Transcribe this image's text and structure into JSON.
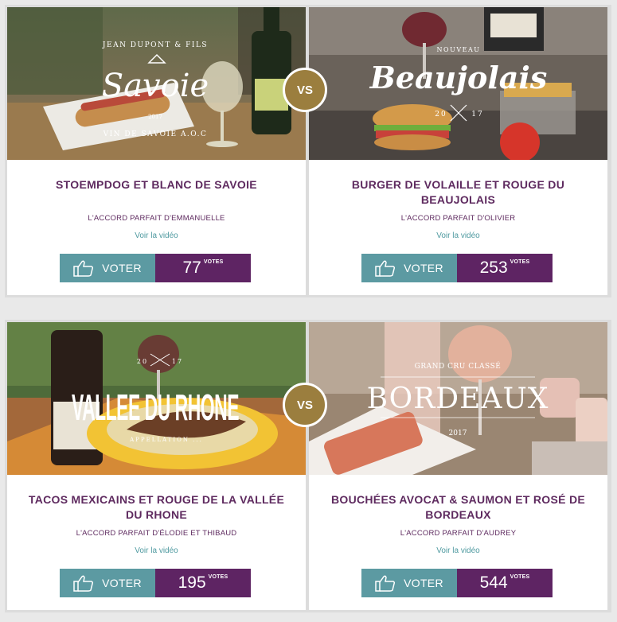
{
  "matchups": [
    {
      "vs": "VS",
      "left": {
        "badge_top": "JEAN DUPONT & FILS",
        "badge_main": "Savoie",
        "badge_year": "2017",
        "badge_bottom": "VIN DE SAVOIE A.O.C",
        "title": "STOEMPDOG ET BLANC DE SAVOIE",
        "subtitle": "L'ACCORD PARFAIT D'EMMANUELLE",
        "video_link": "Voir la vidéo",
        "vote_label": "VOTER",
        "votes": "77",
        "votes_label": "VOTES"
      },
      "right": {
        "badge_top": "NOUVEAU",
        "badge_main": "Beaujolais",
        "badge_year_left": "20",
        "badge_year_right": "17",
        "title": "BURGER DE VOLAILLE ET ROUGE DU BEAUJOLAIS",
        "subtitle": "L'ACCORD PARFAIT D'OLIVIER",
        "video_link": "Voir la vidéo",
        "vote_label": "VOTER",
        "votes": "253",
        "votes_label": "VOTES"
      }
    },
    {
      "vs": "VS",
      "left": {
        "badge_year_left": "20",
        "badge_year_right": "17",
        "badge_main": "VALLEE DU RHONE",
        "badge_bottom": "APPELLATION ...",
        "title": "TACOS MEXICAINS ET ROUGE DE LA VALLÉE DU RHONE",
        "subtitle": "L'ACCORD PARFAIT D'ÉLODIE ET THIBAUD",
        "video_link": "Voir la vidéo",
        "vote_label": "VOTER",
        "votes": "195",
        "votes_label": "VOTES"
      },
      "right": {
        "badge_top": "GRAND CRU CLASSÉ",
        "badge_main": "BORDEAUX",
        "badge_year": "2017",
        "title": "BOUCHÉES AVOCAT & SAUMON ET ROSÉ DE BORDEAUX",
        "subtitle": "L'ACCORD PARFAIT D'AUDREY",
        "video_link": "Voir la vidéo",
        "vote_label": "VOTER",
        "votes": "544",
        "votes_label": "VOTES"
      }
    }
  ],
  "colors": {
    "title": "#5e2a5f",
    "voter_bg": "#5c9aa2",
    "count_bg": "#5e2463",
    "vs_bg": "#9b7e3e",
    "link": "#4f9aa0"
  }
}
